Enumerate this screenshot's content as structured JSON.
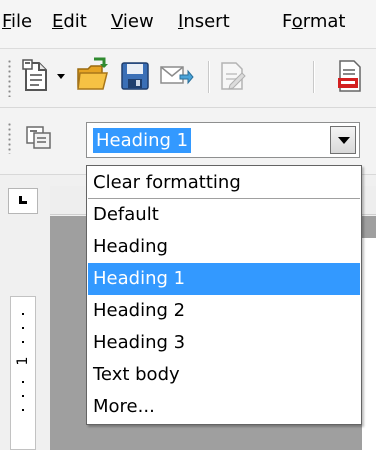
{
  "menubar": {
    "items": [
      {
        "pre": "",
        "u": "F",
        "post": "ile"
      },
      {
        "pre": "",
        "u": "E",
        "post": "dit"
      },
      {
        "pre": "",
        "u": "V",
        "post": "iew"
      },
      {
        "pre": "",
        "u": "I",
        "post": "nsert"
      },
      {
        "pre": "F",
        "u": "o",
        "post": "rmat"
      }
    ]
  },
  "toolbar": {
    "icons": [
      "new-document-icon",
      "dropdown-arrow-icon",
      "open-folder-icon",
      "save-icon",
      "email-icon",
      "edit-file-icon",
      "export-pdf-icon"
    ]
  },
  "formatting": {
    "styles_icon": "styles-formatting-icon",
    "style_value": "Heading 1"
  },
  "style_list": {
    "items": [
      "Clear formatting",
      "Default",
      "Heading",
      "Heading 1",
      "Heading 2",
      "Heading 3",
      "Text body",
      "More..."
    ],
    "selected": "Heading 1"
  },
  "ruler": {
    "vertical_label": "1"
  },
  "colors": {
    "selection": "#3399ff",
    "document_background": "#9f9f9f"
  }
}
